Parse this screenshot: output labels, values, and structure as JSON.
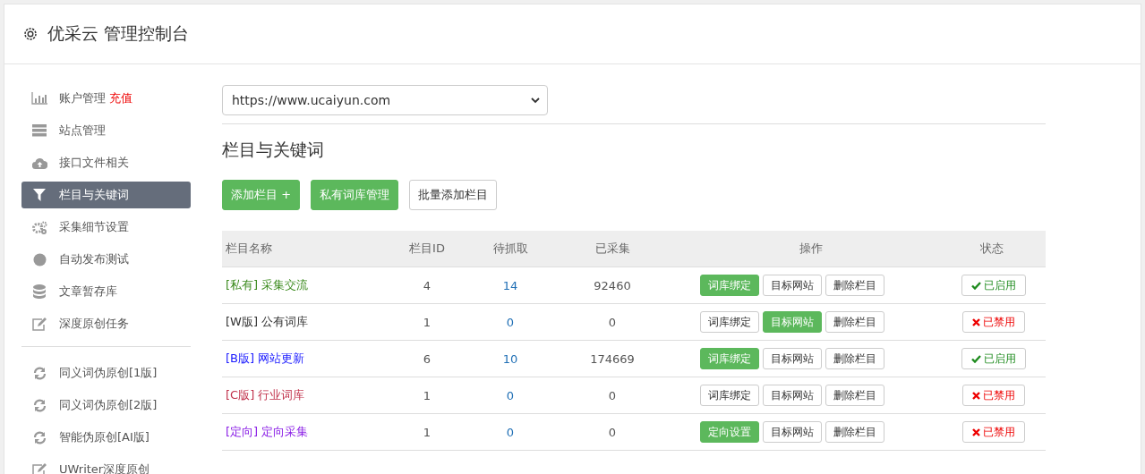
{
  "header": {
    "title": "优采云 管理控制台"
  },
  "sidebar": {
    "groups": [
      {
        "items": [
          {
            "label": "账户管理",
            "badge": "充值",
            "selected": false
          },
          {
            "label": "站点管理",
            "selected": false
          },
          {
            "label": "接口文件相关",
            "selected": false
          },
          {
            "label": "栏目与关键词",
            "selected": true
          },
          {
            "label": "采集细节设置",
            "selected": false
          },
          {
            "label": "自动发布测试",
            "selected": false
          },
          {
            "label": "文章暂存库",
            "selected": false
          },
          {
            "label": "深度原创任务",
            "selected": false
          }
        ]
      },
      {
        "items": [
          {
            "label": "同义词伪原创[1版]",
            "selected": false
          },
          {
            "label": "同义词伪原创[2版]",
            "selected": false
          },
          {
            "label": "智能伪原创[AI版]",
            "selected": false
          },
          {
            "label": "UWriter深度原创",
            "selected": false
          }
        ]
      }
    ]
  },
  "site_select": {
    "value": "https://www.ucaiyun.com"
  },
  "section_title": "栏目与关键词",
  "toolbar": [
    {
      "label": "添加栏目 +",
      "kind": "primary"
    },
    {
      "label": "私有词库管理",
      "kind": "primary"
    },
    {
      "label": "批量添加栏目",
      "kind": "default"
    }
  ],
  "table": {
    "columns": [
      "栏目名称",
      "栏目ID",
      "待抓取",
      "已采集",
      "操作",
      "状态"
    ],
    "rows": [
      {
        "tag": "[私有]",
        "name": "采集交流",
        "color": "#3c8b1e",
        "id": "4",
        "pending": "14",
        "collected": "92460",
        "actions": [
          {
            "label": "词库绑定",
            "kind": "primary"
          },
          {
            "label": "目标网站",
            "kind": "default"
          },
          {
            "label": "删除栏目",
            "kind": "default"
          }
        ],
        "status": {
          "label": "已启用",
          "enabled": true
        }
      },
      {
        "tag": "[W版]",
        "name": "公有词库",
        "color": "#333333",
        "id": "1",
        "pending": "0",
        "collected": "0",
        "actions": [
          {
            "label": "词库绑定",
            "kind": "default"
          },
          {
            "label": "目标网站",
            "kind": "primary"
          },
          {
            "label": "删除栏目",
            "kind": "default"
          }
        ],
        "status": {
          "label": "已禁用",
          "enabled": false
        }
      },
      {
        "tag": "[B版]",
        "name": "网站更新",
        "color": "#1a1aff",
        "id": "6",
        "pending": "10",
        "collected": "174669",
        "actions": [
          {
            "label": "词库绑定",
            "kind": "primary"
          },
          {
            "label": "目标网站",
            "kind": "default"
          },
          {
            "label": "删除栏目",
            "kind": "default"
          }
        ],
        "status": {
          "label": "已启用",
          "enabled": true
        }
      },
      {
        "tag": "[C版]",
        "name": "行业词库",
        "color": "#c0304a",
        "id": "1",
        "pending": "0",
        "collected": "0",
        "actions": [
          {
            "label": "词库绑定",
            "kind": "default"
          },
          {
            "label": "目标网站",
            "kind": "default"
          },
          {
            "label": "删除栏目",
            "kind": "default"
          }
        ],
        "status": {
          "label": "已禁用",
          "enabled": false
        }
      },
      {
        "tag": "[定向]",
        "name": "定向采集",
        "color": "#8a1ee6",
        "id": "1",
        "pending": "0",
        "collected": "0",
        "actions": [
          {
            "label": "定向设置",
            "kind": "primary"
          },
          {
            "label": "目标网站",
            "kind": "default"
          },
          {
            "label": "删除栏目",
            "kind": "default"
          }
        ],
        "status": {
          "label": "已禁用",
          "enabled": false
        }
      }
    ]
  }
}
